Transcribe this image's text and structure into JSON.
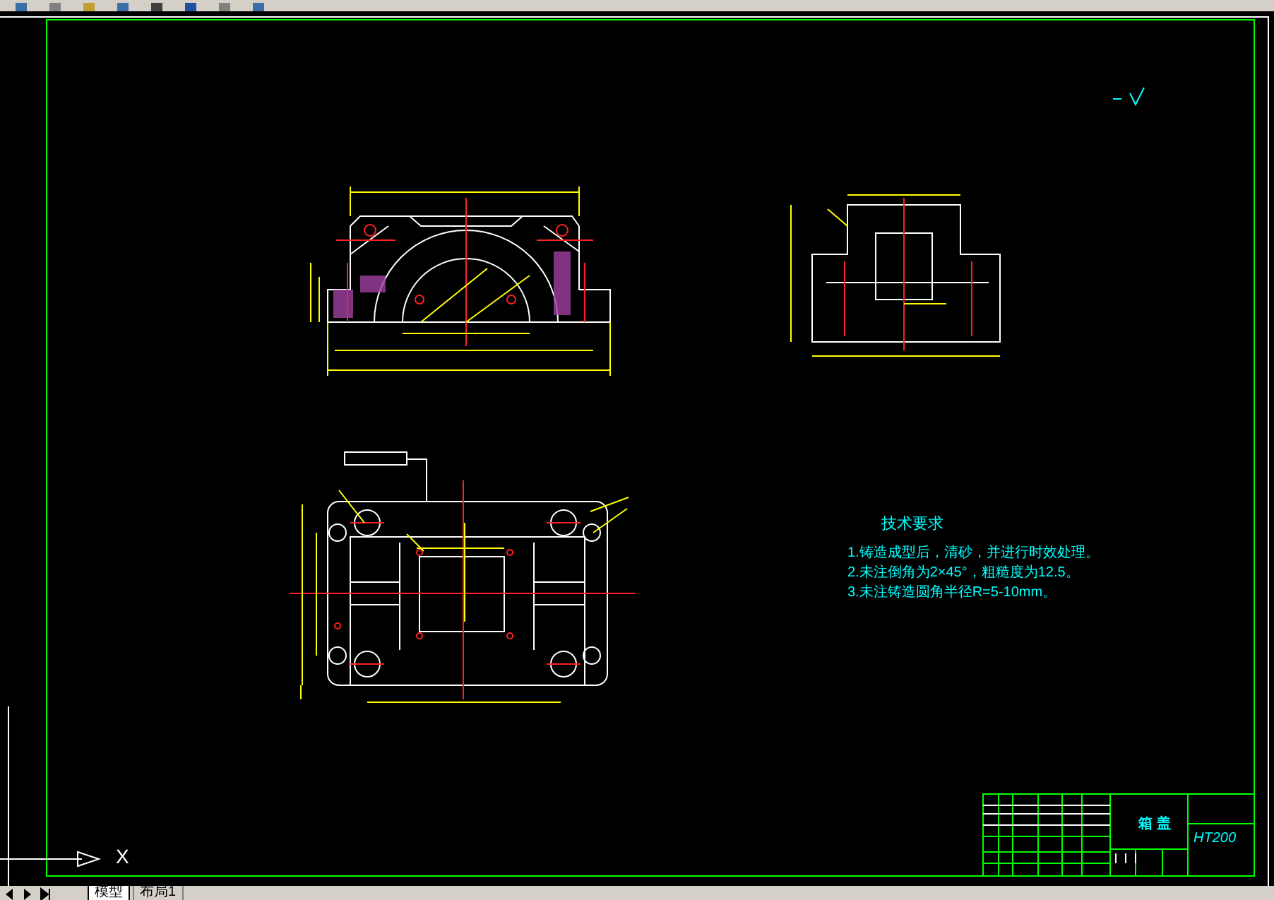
{
  "drawing": {
    "technical_requirements": {
      "title": "技术要求",
      "items": [
        "1.铸造成型后，清砂，并进行时效处理。",
        "2.未注倒角为2×45°，粗糙度为12.5。",
        "3.未注铸造圆角半径R=5-10mm。"
      ]
    },
    "title_block": {
      "part_name": "箱 盖",
      "material": "HT200"
    },
    "ucs": {
      "x_label": "X"
    }
  },
  "tabs": [
    {
      "label": "模型",
      "selected": true
    },
    {
      "label": "布局1",
      "selected": false
    }
  ]
}
